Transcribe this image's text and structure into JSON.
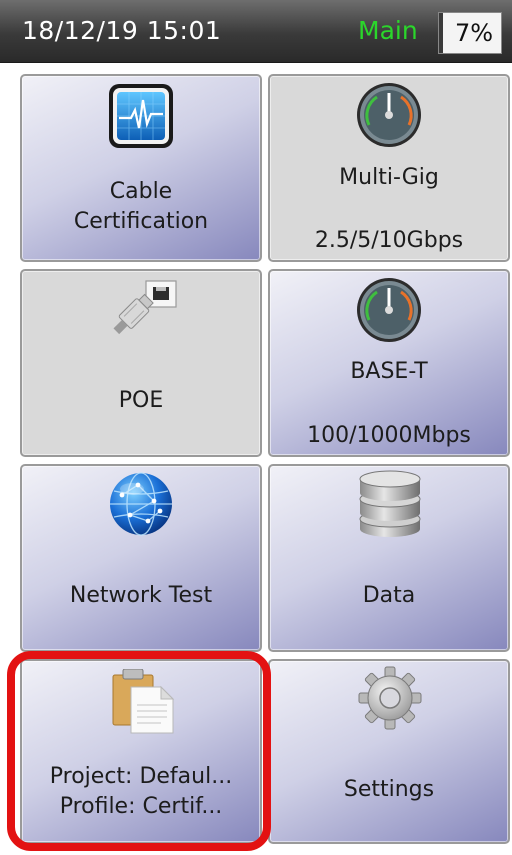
{
  "status": {
    "datetime": "18/12/19 15:01",
    "mode": "Main",
    "battery_percent": 7,
    "battery_label": "7%"
  },
  "tiles": {
    "cable_certification": {
      "line1": "Cable",
      "line2": "Certification",
      "icon": "cable-analyzer-icon"
    },
    "multi_gig": {
      "title": "Multi-Gig",
      "speed": "2.5/5/10Gbps",
      "icon": "speedometer-icon"
    },
    "poe": {
      "title": "POE",
      "icon": "ethernet-plug-icon"
    },
    "base_t": {
      "title": "BASE-T",
      "speed": "100/1000Mbps",
      "icon": "speedometer-icon"
    },
    "network_test": {
      "title": "Network Test",
      "icon": "globe-icon"
    },
    "data": {
      "title": "Data",
      "icon": "database-icon"
    },
    "project": {
      "project_line": "Project: Defaul...",
      "profile_line": "Profile: Certif...",
      "icon": "clipboard-document-icon"
    },
    "settings": {
      "title": "Settings",
      "icon": "gear-icon"
    }
  },
  "colors": {
    "status_bg": "#3a3a3a",
    "mode_text": "#2bd62b",
    "tile_blue_dark": "#8788bd",
    "tile_gray": "#d9d9d9",
    "highlight": "#e31212"
  }
}
